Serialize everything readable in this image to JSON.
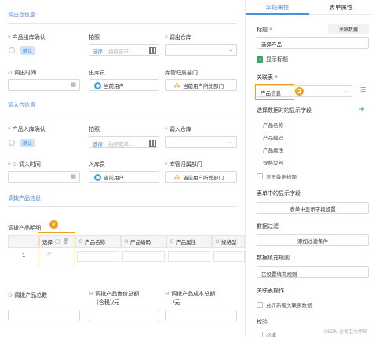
{
  "form": {
    "sec_out": "调出仓信息",
    "out_confirm_label": "产品出库确认",
    "out_confirm_btn": "确认",
    "out_photo_label": "拍照",
    "out_photo_select": "选择",
    "out_photo_ph": "拍照或单...",
    "out_wh_label": "调出仓库",
    "out_time_label": "调出时间",
    "out_user_label": "出库员",
    "out_user_value": "当前用户",
    "out_dept_label": "库管归属部门",
    "out_dept_value": "当前用户所处部门",
    "sec_in": "调入仓信息",
    "in_confirm_label": "产品入库确认",
    "in_confirm_btn": "确认",
    "in_photo_label": "拍照",
    "in_photo_select": "选择",
    "in_photo_ph": "拍照或单...",
    "in_wh_label": "调入仓库",
    "in_time_label": "调入时间",
    "in_user_label": "入库员",
    "in_user_value": "当前用户",
    "in_dept_label": "库管归属部门",
    "in_dept_value": "当前用户所处部门",
    "sec_product": "调拨产品信息",
    "detail_label": "调拨产品明细",
    "detail_cols": [
      "选择",
      "产品名称",
      "产品编码",
      "产品属性",
      "规格型"
    ],
    "row_index": "1",
    "badge1": "1",
    "sum_qty_label": "调拨产品总数",
    "sum_price_label_1": "调拨产品售价总额",
    "sum_price_label_2": "(含税)/元",
    "sum_cost_label_1": "调拨产品成本总额",
    "sum_cost_label_2": "/元"
  },
  "panel": {
    "tab_field": "字段属性",
    "tab_form": "表单属性",
    "title_label": "标题",
    "title_link": "关联数据",
    "title_value": "选择产品",
    "show_title": "显示标题",
    "related_table_label": "关联表",
    "related_table_value": "产品信息",
    "badge2": "2",
    "fields_label": "选择数据时的显示字段",
    "fields": [
      "产品名称",
      "产品编码",
      "产品属性",
      "规格型号"
    ],
    "show_search": "显示数据标题",
    "form_display_label": "表单中的显示字段",
    "form_display_btn": "表单中显示字段设置",
    "data_filter_label": "数据过滤",
    "data_filter_btn": "添加过滤条件",
    "fill_rule_label": "数据填充规则",
    "fill_rule_btn": "已设置填充规则",
    "assoc_op_label": "关联表操作",
    "assoc_op_option": "允许新增关联表数据",
    "validate_label": "校验",
    "validate_option": "必填",
    "watermark": "CSDN @保卫大师兄"
  }
}
